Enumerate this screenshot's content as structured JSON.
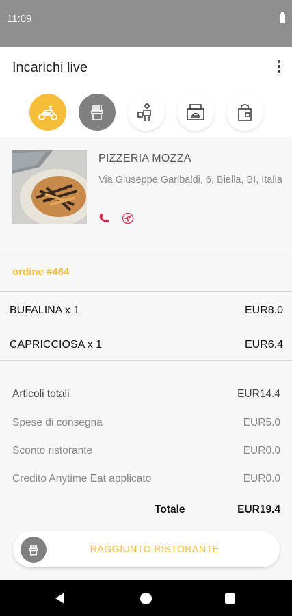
{
  "status_bar": {
    "time": "11:09"
  },
  "header": {
    "title": "Incarichi live",
    "menu_icon": "more-vert-icon"
  },
  "steps": [
    {
      "icon": "scooter-icon",
      "state": "active"
    },
    {
      "icon": "restaurant-icon",
      "state": "done"
    },
    {
      "icon": "courier-icon",
      "state": "pending"
    },
    {
      "icon": "shop-icon",
      "state": "pending"
    },
    {
      "icon": "bag-icon",
      "state": "pending"
    }
  ],
  "restaurant": {
    "name": "PIZZERIA MOZZA",
    "address": "Via Giuseppe Garibaldi, 6, Biella, BI, Italia",
    "phone_icon": "phone-icon",
    "nav_icon": "navigation-icon"
  },
  "order": {
    "label": "ordine #464"
  },
  "items": [
    {
      "name": "BUFALINA x 1",
      "price": "EUR8.0"
    },
    {
      "name": "CAPRICCIOSA x 1",
      "price": "EUR6.4"
    }
  ],
  "totals": [
    {
      "label": "Articoli totali",
      "value": "EUR14.4"
    },
    {
      "label": "Spese di consegna",
      "value": "EUR5.0"
    },
    {
      "label": "Sconto ristorante",
      "value": "EUR0.0"
    },
    {
      "label": "Credito Anytime Eat applicato",
      "value": "EUR0.0"
    }
  ],
  "grand_total": {
    "label": "Totale",
    "value": "EUR19.4"
  },
  "action": {
    "label": "RAGGIUNTO RISTORANTE",
    "icon": "restaurant-icon"
  },
  "colors": {
    "accent": "#f6bd3b",
    "done": "#808080",
    "phone": "#e0284a"
  }
}
